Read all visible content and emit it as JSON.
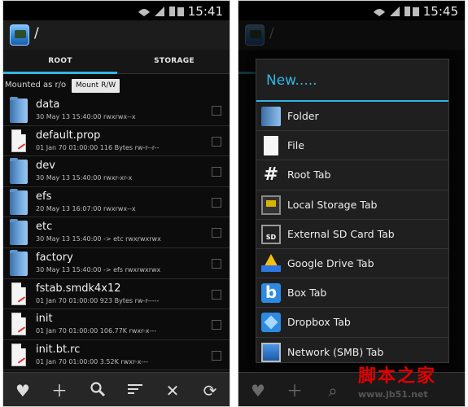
{
  "left_screen": {
    "status_time": "15:41",
    "path": "/",
    "tabs": [
      {
        "label": "ROOT",
        "active": true
      },
      {
        "label": "STORAGE",
        "active": false
      }
    ],
    "mount_label": "Mounted as r/o",
    "mount_button": "Mount R/W",
    "files": [
      {
        "name": "data",
        "meta": "30 May 13 15:40:00   rwxrwx--x",
        "kind": "folder"
      },
      {
        "name": "default.prop",
        "meta": "01 Jan 70 01:00:00  116 Bytes  rw-r--r--",
        "kind": "file"
      },
      {
        "name": "dev",
        "meta": "30 May 13 15:40:00   rwxr-xr-x",
        "kind": "folder"
      },
      {
        "name": "efs",
        "meta": "20 May 13 16:07:00   rwxrwx--x",
        "kind": "folder"
      },
      {
        "name": "etc",
        "meta": "30 May 13 15:40:00  -> etc  rwxrwxrwx",
        "kind": "folder"
      },
      {
        "name": "factory",
        "meta": "30 May 13 15:40:00  -> efs  rwxrwxrwx",
        "kind": "folder"
      },
      {
        "name": "fstab.smdk4x12",
        "meta": "01 Jan 70 01:00:00  923 Bytes  rw-r-----",
        "kind": "file"
      },
      {
        "name": "init",
        "meta": "01 Jan 70 01:00:00  106.77K  rwxr-x---",
        "kind": "file"
      },
      {
        "name": "init.bt.rc",
        "meta": "01 Jan 70 01:00:00  3.52K  rwxr-x---",
        "kind": "file"
      }
    ],
    "bottom_icons": [
      "heart-icon",
      "plus-icon",
      "search-icon",
      "sort-icon",
      "close-icon",
      "refresh-icon"
    ]
  },
  "right_screen": {
    "status_time": "15:45",
    "path": "/",
    "dialog_title": "New.....",
    "menu_items": [
      {
        "label": "Folder",
        "icon": "folder-icon"
      },
      {
        "label": "File",
        "icon": "file-icon"
      },
      {
        "label": "Root Tab",
        "icon": "hash-icon"
      },
      {
        "label": "Local Storage Tab",
        "icon": "sd-icon"
      },
      {
        "label": "External SD Card Tab",
        "icon": "sdcard-icon"
      },
      {
        "label": "Google Drive Tab",
        "icon": "google-drive-icon"
      },
      {
        "label": "Box Tab",
        "icon": "box-icon"
      },
      {
        "label": "Dropbox Tab",
        "icon": "dropbox-icon"
      },
      {
        "label": "Network (SMB) Tab",
        "icon": "network-icon"
      }
    ]
  },
  "watermark": {
    "text": "脚本之家",
    "url": "www.jb51.net"
  },
  "colors": {
    "accent": "#33b5e5",
    "background": "#0c0c0c",
    "watermark": "#e00000"
  }
}
